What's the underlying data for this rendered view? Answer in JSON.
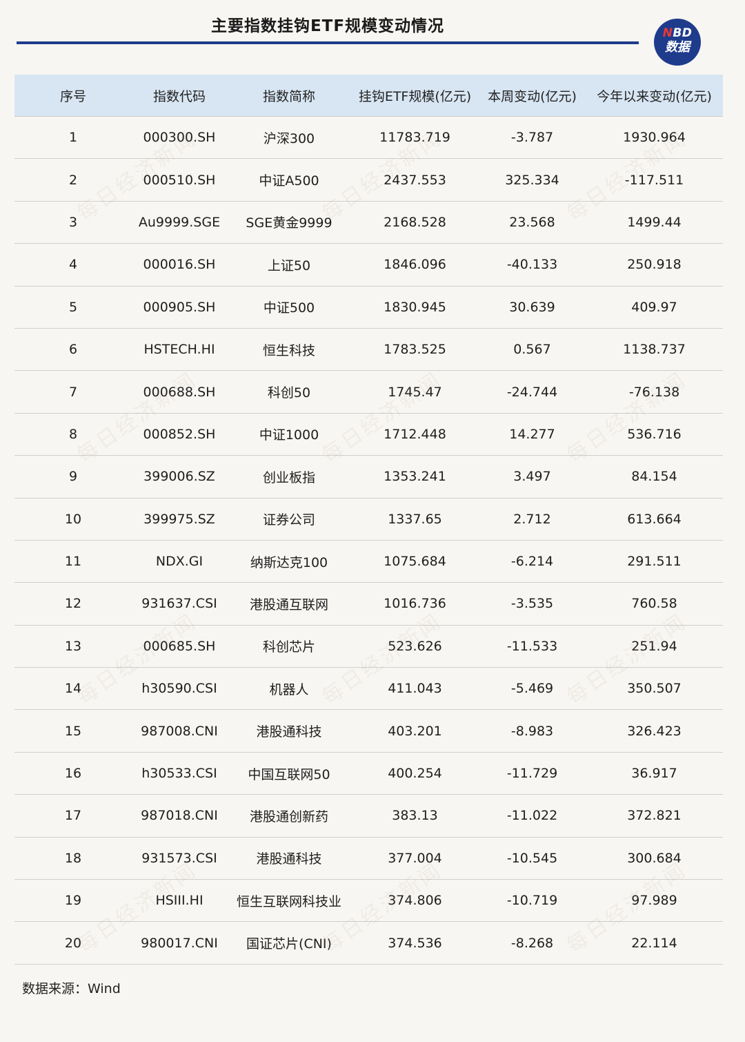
{
  "header": {
    "title": "主要指数挂钩ETF规模变动情况",
    "logo_top": "NBD",
    "logo_bottom": "数据",
    "brand_color": "#1f3c8c",
    "header_bg": "#d8e6f3"
  },
  "chart_data": {
    "type": "table",
    "title": "主要指数挂钩ETF规模变动情况",
    "columns": [
      "序号",
      "指数代码",
      "指数简称",
      "挂钩ETF规模(亿元)",
      "本周变动(亿元)",
      "今年以来变动(亿元)"
    ],
    "rows": [
      [
        "1",
        "000300.SH",
        "沪深300",
        "11783.719",
        "-3.787",
        "1930.964"
      ],
      [
        "2",
        "000510.SH",
        "中证A500",
        "2437.553",
        "325.334",
        "-117.511"
      ],
      [
        "3",
        "Au9999.SGE",
        "SGE黄金9999",
        "2168.528",
        "23.568",
        "1499.44"
      ],
      [
        "4",
        "000016.SH",
        "上证50",
        "1846.096",
        "-40.133",
        "250.918"
      ],
      [
        "5",
        "000905.SH",
        "中证500",
        "1830.945",
        "30.639",
        "409.97"
      ],
      [
        "6",
        "HSTECH.HI",
        "恒生科技",
        "1783.525",
        "0.567",
        "1138.737"
      ],
      [
        "7",
        "000688.SH",
        "科创50",
        "1745.47",
        "-24.744",
        "-76.138"
      ],
      [
        "8",
        "000852.SH",
        "中证1000",
        "1712.448",
        "14.277",
        "536.716"
      ],
      [
        "9",
        "399006.SZ",
        "创业板指",
        "1353.241",
        "3.497",
        "84.154"
      ],
      [
        "10",
        "399975.SZ",
        "证券公司",
        "1337.65",
        "2.712",
        "613.664"
      ],
      [
        "11",
        "NDX.GI",
        "纳斯达克100",
        "1075.684",
        "-6.214",
        "291.511"
      ],
      [
        "12",
        "931637.CSI",
        "港股通互联网",
        "1016.736",
        "-3.535",
        "760.58"
      ],
      [
        "13",
        "000685.SH",
        "科创芯片",
        "523.626",
        "-11.533",
        "251.94"
      ],
      [
        "14",
        "h30590.CSI",
        "机器人",
        "411.043",
        "-5.469",
        "350.507"
      ],
      [
        "15",
        "987008.CNI",
        "港股通科技",
        "403.201",
        "-8.983",
        "326.423"
      ],
      [
        "16",
        "h30533.CSI",
        "中国互联网50",
        "400.254",
        "-11.729",
        "36.917"
      ],
      [
        "17",
        "987018.CNI",
        "港股通创新药",
        "383.13",
        "-11.022",
        "372.821"
      ],
      [
        "18",
        "931573.CSI",
        "港股通科技",
        "377.004",
        "-10.545",
        "300.684"
      ],
      [
        "19",
        "HSIII.HI",
        "恒生互联网科技业",
        "374.806",
        "-10.719",
        "97.989"
      ],
      [
        "20",
        "980017.CNI",
        "国证芯片(CNI)",
        "374.536",
        "-8.268",
        "22.114"
      ]
    ]
  },
  "footer": {
    "source": "数据来源：Wind"
  },
  "watermark": "每日经济新闻"
}
